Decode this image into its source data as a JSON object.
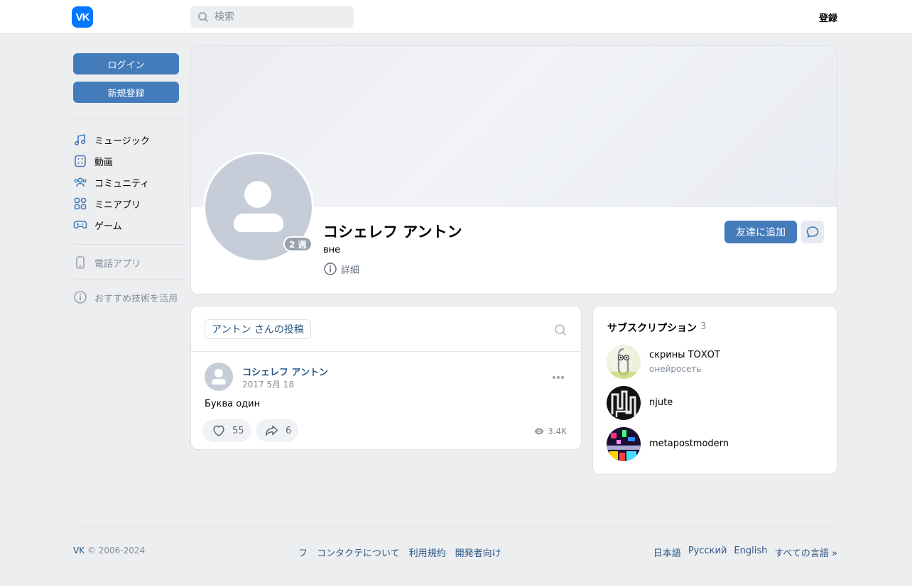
{
  "header": {
    "logo_text": "VK",
    "search_placeholder": "検索",
    "signup_label": "登録"
  },
  "sidebar": {
    "login_button": "ログイン",
    "register_button": "新規登録",
    "items": [
      {
        "label": "ミュージック",
        "icon": "music-icon"
      },
      {
        "label": "動画",
        "icon": "video-icon"
      },
      {
        "label": "コミュニティ",
        "icon": "community-icon"
      },
      {
        "label": "ミニアプリ",
        "icon": "apps-icon"
      },
      {
        "label": "ゲーム",
        "icon": "gamepad-icon"
      }
    ],
    "phone_app": {
      "label": "電話アプリ",
      "icon": "phone-icon"
    },
    "tech": {
      "label": "おすすめ技術を活用",
      "icon": "info-icon"
    }
  },
  "profile": {
    "name": "コシェレフ アントン",
    "status": "вне",
    "last_seen_badge": "2 週",
    "details_label": "詳細",
    "add_friend_label": "友達に追加",
    "message_icon": "message-icon"
  },
  "wall": {
    "tab_label": "アントン さんの投稿",
    "post": {
      "author": "コシェレフ アントン",
      "date": "2017 5月 18",
      "text": "Буква один",
      "likes": "55",
      "shares": "6",
      "views": "3.4K"
    }
  },
  "subscriptions": {
    "title": "サブスクリプション",
    "count": "3",
    "items": [
      {
        "name": "скрины ТОХОТ",
        "desc": "онейросеть"
      },
      {
        "name": "njute",
        "desc": ""
      },
      {
        "name": "metapostmodern",
        "desc": ""
      }
    ]
  },
  "footer": {
    "copyright_brand": "VK",
    "copyright_years": "© 2006-2024",
    "links": [
      "フ",
      "コンタクテについて",
      "利用規約",
      "開発者向け"
    ],
    "languages": [
      "日本語",
      "Русский",
      "English",
      "すべての言語 »"
    ]
  },
  "colors": {
    "brand": "#0077ff",
    "button": "#447bba",
    "link": "#2a5885",
    "background": "#edeef0"
  }
}
